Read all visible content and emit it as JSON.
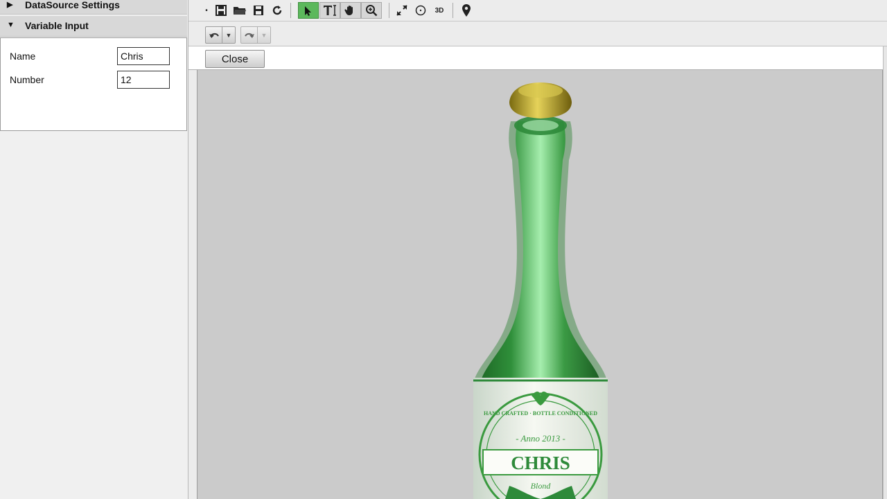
{
  "sidebar": {
    "datasource_header": "DataSource Settings",
    "variable_header": "Variable Input",
    "fields": [
      {
        "label": "Name",
        "value": "Chris"
      },
      {
        "label": "Number",
        "value": "12"
      }
    ]
  },
  "toolbar": {
    "icons": [
      "dot-icon",
      "save-icon",
      "open-folder-icon",
      "save-as-icon",
      "refresh-icon",
      "select-arrow-icon",
      "text-tool-icon",
      "pan-hand-icon",
      "zoom-icon",
      "fit-view-icon",
      "circle-icon",
      "3d-icon",
      "location-pin-icon"
    ]
  },
  "actions": {
    "close_label": "Close"
  },
  "label_art": {
    "top_ring": "HAND CRAFTED · BOTTLE CONDITIONED",
    "anno": "- Anno 2013 -",
    "name": "CHRIS",
    "style": "Blond"
  },
  "colors": {
    "bottle_green": "#2f8f3a",
    "label_green": "#3a9a3f",
    "cap_gold": "#b8a020",
    "viewport_bg": "#cbcbcb"
  }
}
